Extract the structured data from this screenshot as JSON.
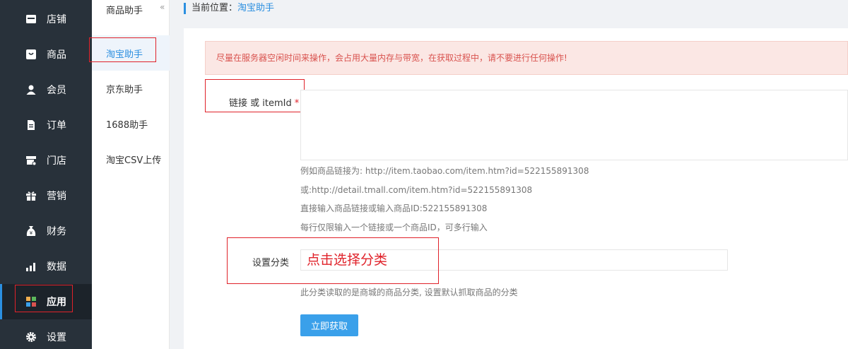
{
  "sidebar": {
    "items": [
      {
        "label": "店铺",
        "icon": "store-icon"
      },
      {
        "label": "商品",
        "icon": "goods-icon"
      },
      {
        "label": "会员",
        "icon": "member-icon"
      },
      {
        "label": "订单",
        "icon": "order-icon"
      },
      {
        "label": "门店",
        "icon": "shop-icon"
      },
      {
        "label": "营销",
        "icon": "gift-icon"
      },
      {
        "label": "财务",
        "icon": "money-bag-icon"
      },
      {
        "label": "数据",
        "icon": "bar-chart-icon"
      },
      {
        "label": "应用",
        "icon": "apps-icon"
      },
      {
        "label": "设置",
        "icon": "gear-icon"
      }
    ],
    "active_index": 8
  },
  "subnav": {
    "title": "商品助手",
    "collapse": "«",
    "items": [
      {
        "label": "淘宝助手"
      },
      {
        "label": "京东助手"
      },
      {
        "label": "1688助手"
      },
      {
        "label": "淘宝CSV上传"
      }
    ]
  },
  "breadcrumb": {
    "prefix": "当前位置：",
    "current": "淘宝助手"
  },
  "form": {
    "alert": "尽量在服务器空闲时间来操作，会占用大量内存与带宽，在获取过程中，请不要进行任何操作!",
    "link_label": "链接 或 itemId",
    "required_mark": "*",
    "link_value": "",
    "hints": [
      "例如商品链接为: http://item.taobao.com/item.htm?id=522155891308",
      "或:http://detail.tmall.com/item.htm?id=522155891308",
      "直接输入商品链接或输入商品ID:522155891308",
      "每行仅限输入一个链接或一个商品ID，可多行输入"
    ],
    "category_label": "设置分类",
    "category_annotation": "点击选择分类",
    "category_hint": "此分类读取的是商城的商品分类, 设置默认抓取商品的分类",
    "submit_label": "立即获取"
  },
  "colors": {
    "sidebar_bg": "#28313a",
    "accent": "#2b8fe0",
    "button": "#3aa0ea",
    "alert_text": "#d9534f",
    "annotation_red": "#e0222a"
  }
}
